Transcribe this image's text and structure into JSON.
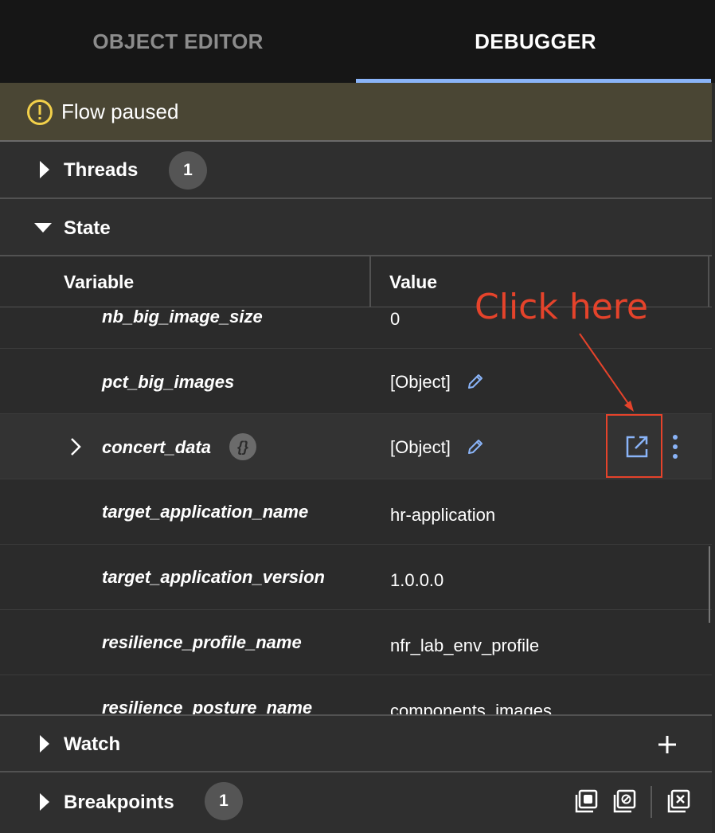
{
  "tabs": [
    {
      "label": "OBJECT EDITOR",
      "active": false
    },
    {
      "label": "DEBUGGER",
      "active": true
    }
  ],
  "status_banner": {
    "icon": "warning-circle-icon",
    "text": "Flow paused",
    "color": "#4a4634"
  },
  "threads": {
    "label": "Threads",
    "count": "1",
    "expanded": false
  },
  "state": {
    "label": "State",
    "expanded": true,
    "columns": [
      "Variable",
      "Value"
    ],
    "rows": [
      {
        "name": "nb_big_image_size",
        "value": "0"
      },
      {
        "name": "pct_big_images",
        "value": "[Object]",
        "editable": true
      },
      {
        "name": "concert_data",
        "value": "[Object]",
        "editable": true,
        "expandable": true,
        "badge": "{}",
        "selected": true
      },
      {
        "name": "target_application_name",
        "value": "hr-application"
      },
      {
        "name": "target_application_version",
        "value": "1.0.0.0"
      },
      {
        "name": "resilience_profile_name",
        "value": "nfr_lab_env_profile"
      },
      {
        "name": "resilience_posture_name",
        "value": "components_images"
      }
    ]
  },
  "annotation": {
    "text": "Click here",
    "color": "#e5432b"
  },
  "watch": {
    "label": "Watch",
    "add_icon": "plus-icon"
  },
  "breakpoints": {
    "label": "Breakpoints",
    "count": "1"
  },
  "accent_color": "#8ab4f8"
}
